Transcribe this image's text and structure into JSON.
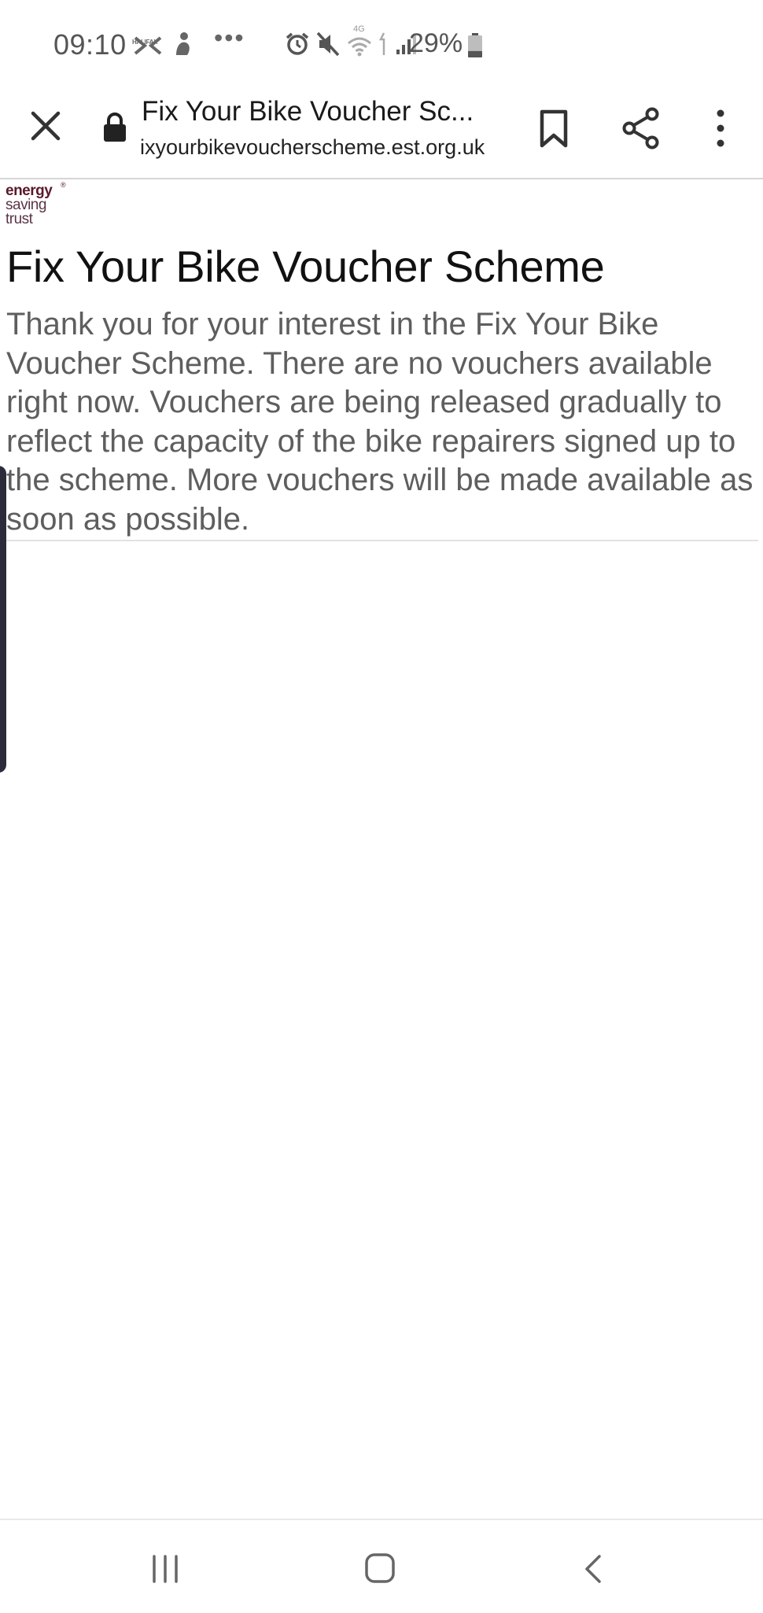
{
  "status_bar": {
    "time": "09:10",
    "halifax_label": "HALIFAX",
    "overflow": "•••",
    "network_label": "4G",
    "battery_percent": "29%",
    "battery_level": 0.29,
    "icons": [
      "halifax-app-icon",
      "figure-icon",
      "alarm-icon",
      "mute-icon",
      "wifi-icon",
      "signal-icon",
      "battery-icon"
    ]
  },
  "toolbar": {
    "page_title": "Fix Your Bike Voucher Sc...",
    "url": "ixyourbikevoucherscheme.est.org.uk",
    "icons": [
      "close-icon",
      "lock-icon",
      "bookmark-icon",
      "share-icon",
      "more-icon"
    ]
  },
  "logo": {
    "line1": "energy",
    "line2": "saving",
    "line3": "trust",
    "reg_mark": "®"
  },
  "page": {
    "heading": "Fix Your Bike Voucher Scheme",
    "message": "Thank you for your interest in the Fix Your Bike Voucher Scheme. There are no vouchers available right now. Vouchers are being released gradually to reflect the capacity of the bike repairers signed up to the scheme. More vouchers will be made available as soon as possible."
  },
  "nav_bar": {
    "icons": [
      "recents-icon",
      "home-icon",
      "back-icon"
    ]
  },
  "colors": {
    "logo": "#5a1a2a",
    "message_text": "#5e5e5e",
    "title_text": "#111111",
    "icon": "#333333",
    "edge_handle": "#2b2b3b"
  }
}
